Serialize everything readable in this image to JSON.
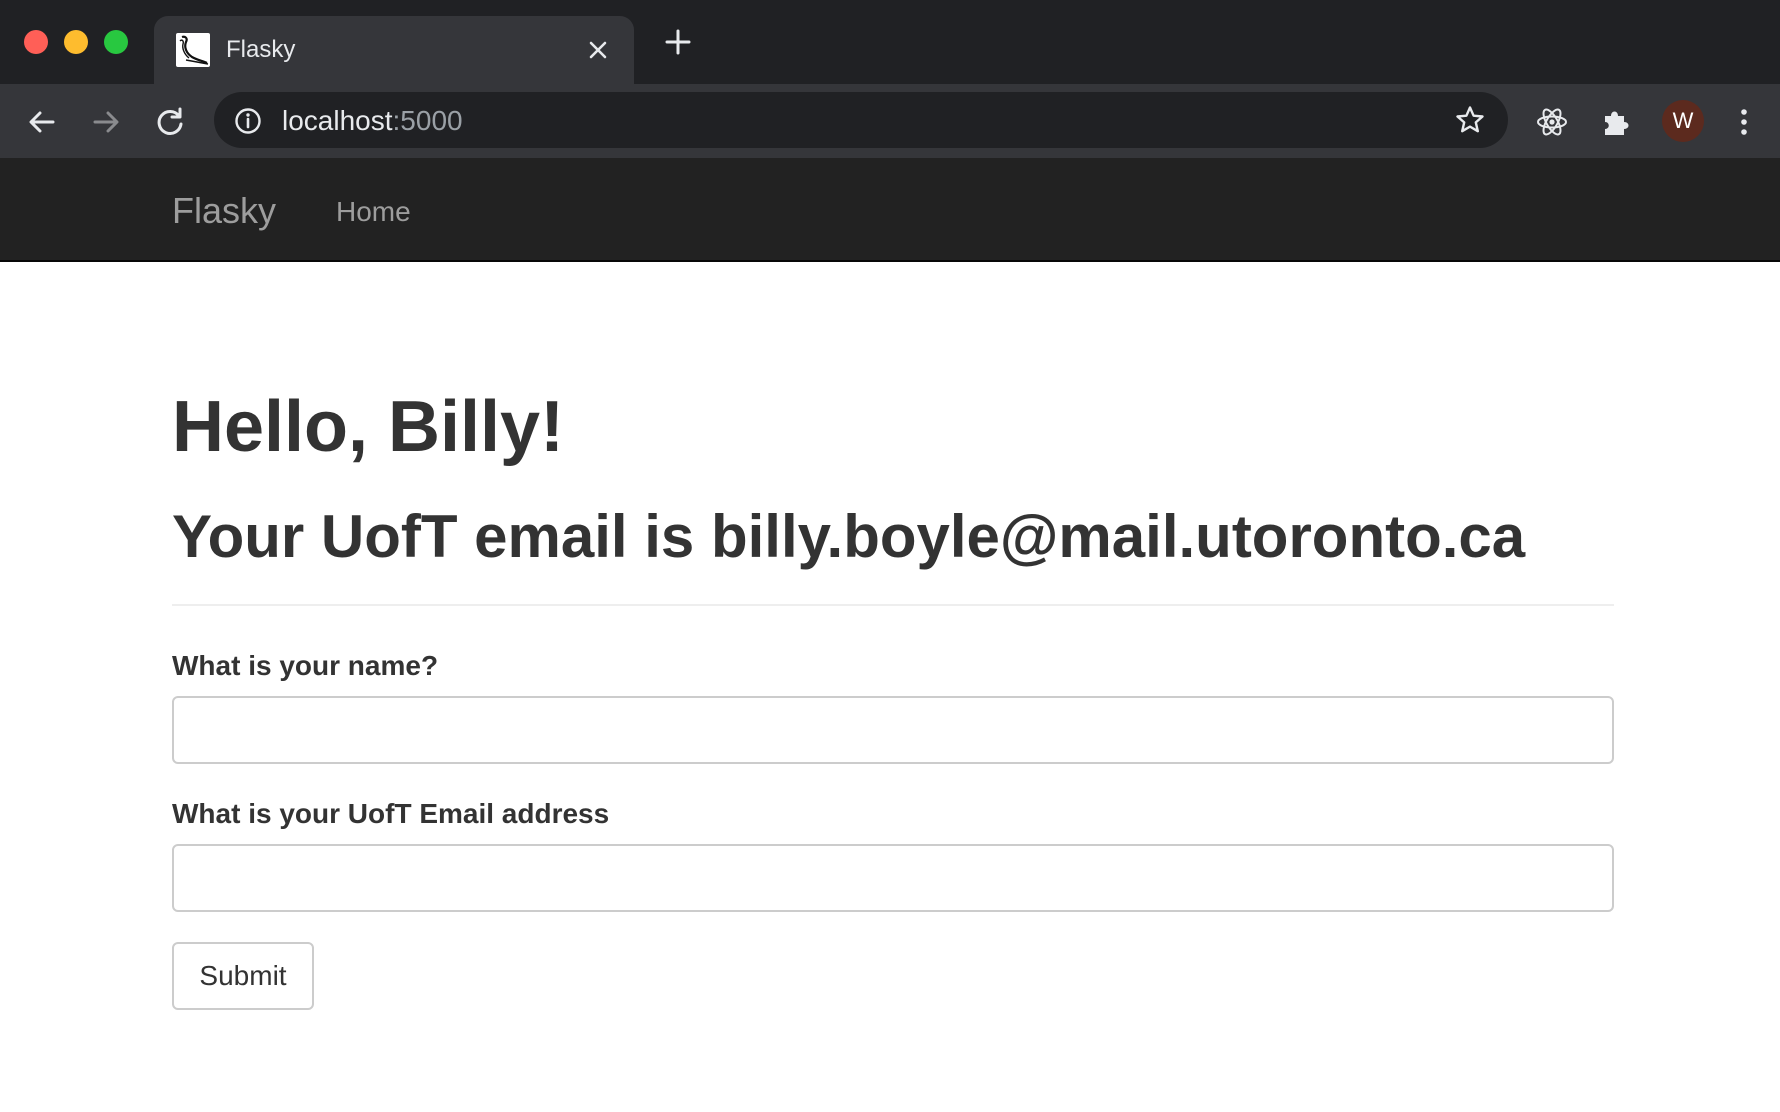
{
  "browser": {
    "tab": {
      "title": "Flasky",
      "favicon": "flask-icon"
    },
    "address": {
      "host": "localhost",
      "port": ":5000"
    },
    "profile_initial": "W",
    "icons": {
      "back": "back-arrow-icon",
      "forward": "forward-arrow-icon",
      "reload": "reload-icon",
      "info": "info-icon",
      "bookmark": "star-icon",
      "react_devtools": "react-icon",
      "extensions": "puzzle-icon",
      "menu": "kebab-menu-icon"
    }
  },
  "navbar": {
    "brand": "Flasky",
    "links": [
      "Home"
    ]
  },
  "main": {
    "greeting": "Hello, Billy!",
    "email_line": "Your UofT email is billy.boyle@mail.utoronto.ca",
    "form": {
      "name_label": "What is your name?",
      "name_value": "",
      "email_label": "What is your UofT Email address",
      "email_value": "",
      "submit_label": "Submit"
    }
  },
  "colors": {
    "navbar_bg": "#222222",
    "nav_text": "#9d9d9d",
    "heading_text": "#333333",
    "chrome_dark": "#202124",
    "chrome_toolbar": "#35363a"
  }
}
